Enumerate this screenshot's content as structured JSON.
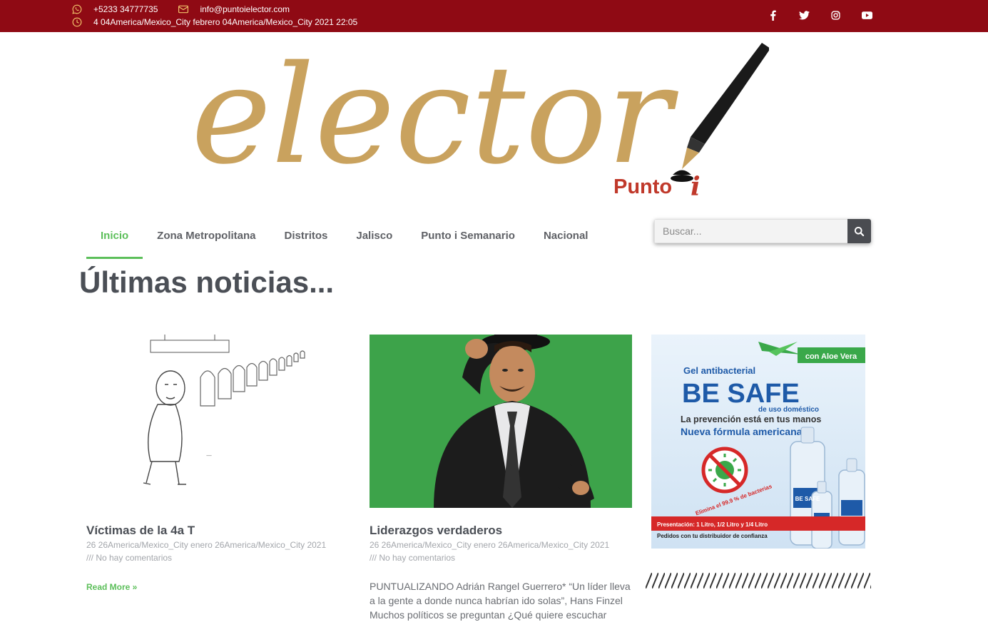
{
  "topbar": {
    "phone": "+5233 34777735",
    "email": "info@puntoielector.com",
    "datetime": "4 04America/Mexico_City febrero 04America/Mexico_City 2021 22:05",
    "social_icons": [
      "facebook-icon",
      "twitter-icon",
      "instagram-icon",
      "youtube-icon"
    ],
    "background_color": "#8f0a14",
    "icon_color": "#f1c36a"
  },
  "logo": {
    "wordmark": "elector",
    "subtitle": "Punto",
    "subtitle_i": "i"
  },
  "nav": {
    "items": [
      {
        "label": "Inicio",
        "active": true
      },
      {
        "label": "Zona Metropolitana",
        "active": false
      },
      {
        "label": "Distritos",
        "active": false
      },
      {
        "label": "Jalisco",
        "active": false
      },
      {
        "label": "Punto i Semanario",
        "active": false
      },
      {
        "label": "Nacional",
        "active": false
      }
    ],
    "active_color": "#5cbf5a"
  },
  "search": {
    "placeholder": "Buscar..."
  },
  "main": {
    "heading": "Últimas noticias..."
  },
  "posts": [
    {
      "title": "Víctimas de la 4a T",
      "date": "26 26America/Mexico_City enero 26America/Mexico_City 2021",
      "comments": "/// No hay comentarios",
      "read_more": "Read More »"
    },
    {
      "title": "Liderazgos verdaderos",
      "date": "26 26America/Mexico_City enero 26America/Mexico_City 2021",
      "comments": "/// No hay comentarios",
      "excerpt": "PUNTUALIZANDO Adrián Rangel Guerrero* “Un líder lleva a la gente a donde nunca habrían ido solas”, Hans Finzel Muchos políticos se preguntan ¿Qué quiere escuchar"
    }
  ],
  "ad": {
    "tag": "con Aloe Vera",
    "line1": "Gel antibacterial",
    "brand": "BE SAFE",
    "line2": "de uso doméstico",
    "line3": "La prevención está en tus manos",
    "line4": "Nueva fórmula americana",
    "badge": "Elimina el 99.9 % de bacterias",
    "footer1": "Presentación: 1 Litro, 1/2 Litro y 1/4 Litro",
    "footer2": "Pedidos con tu distribuidor de confianza",
    "bottle_label": "BE SAFE"
  }
}
